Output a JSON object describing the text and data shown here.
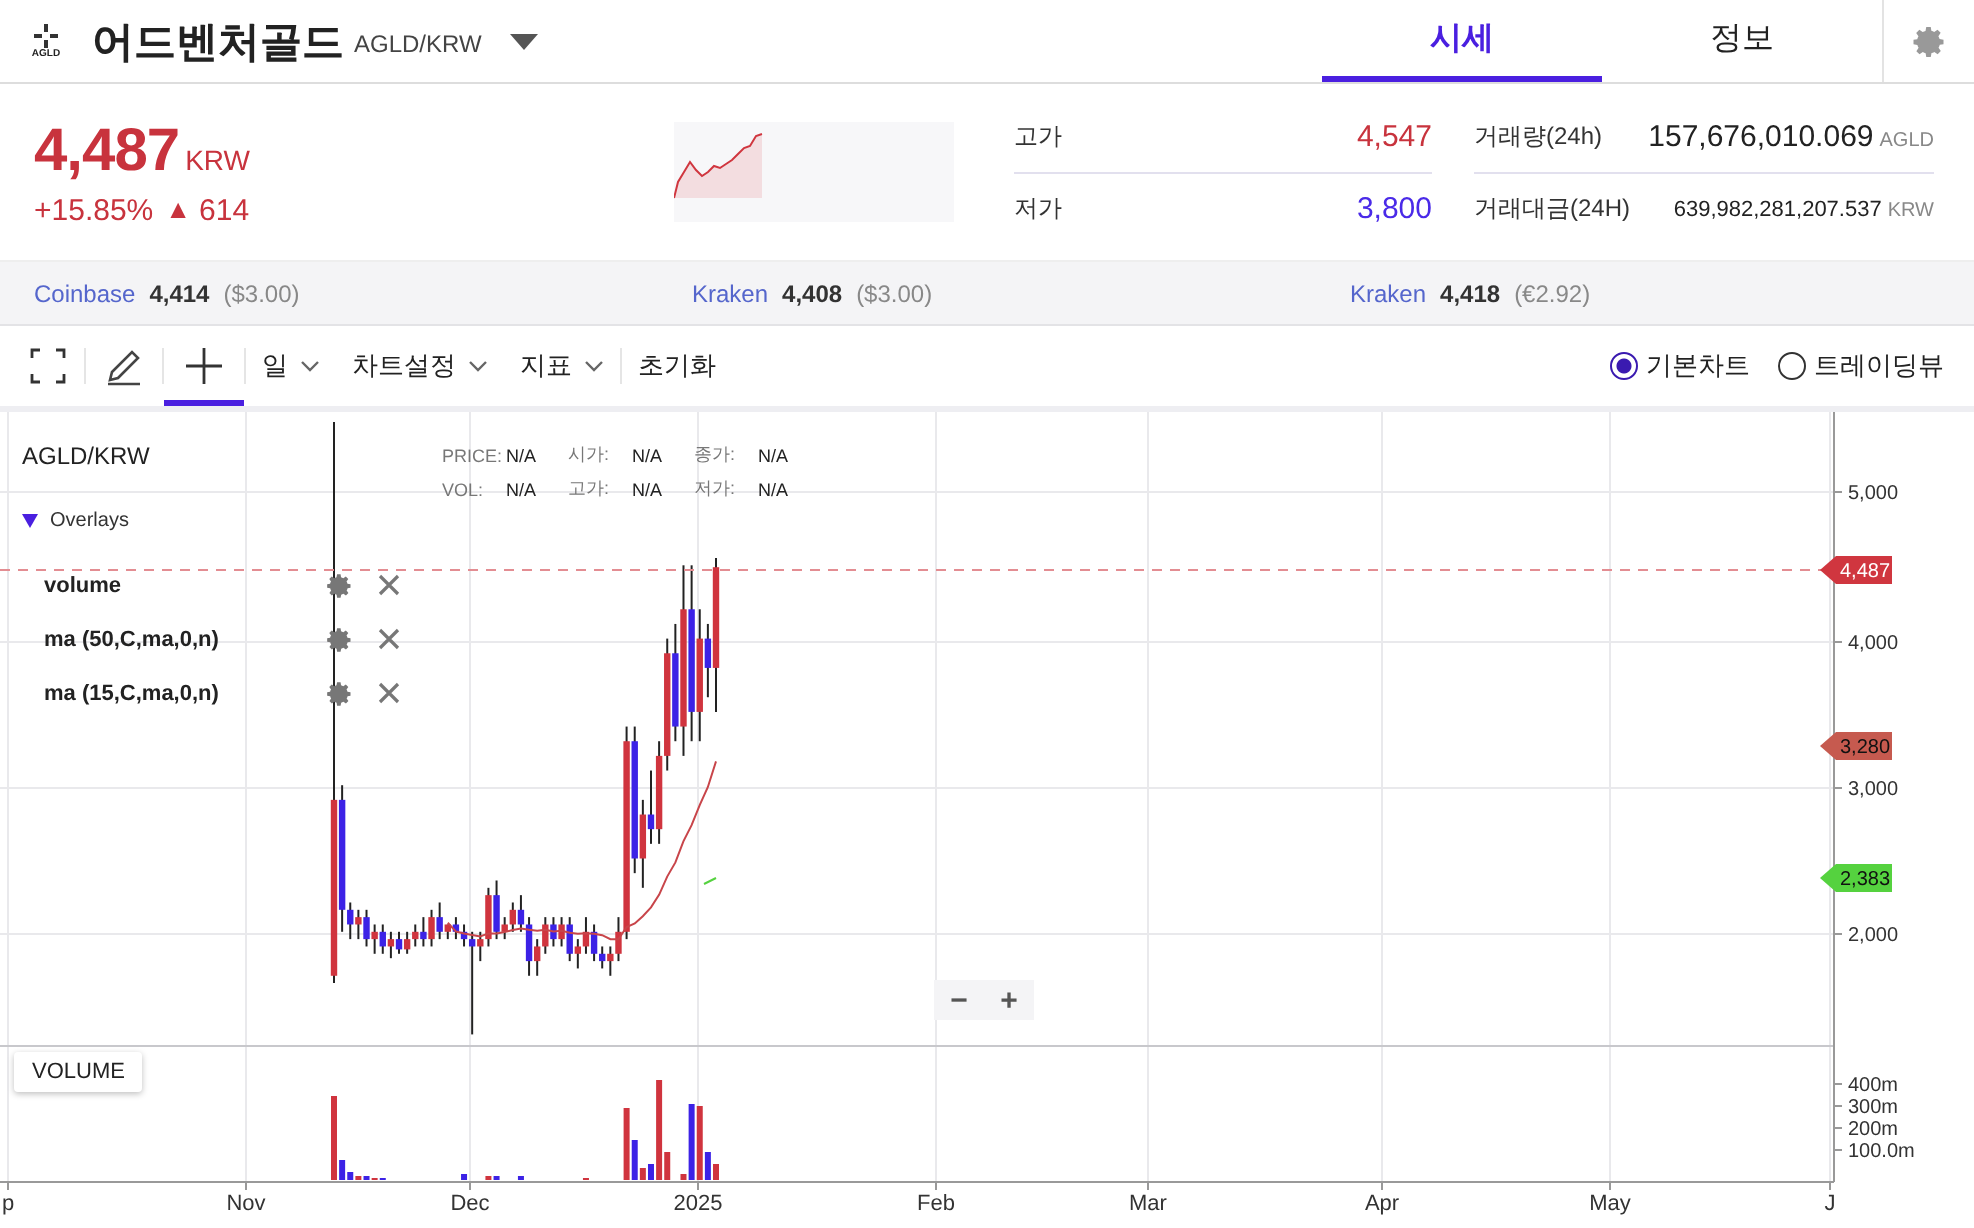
{
  "header": {
    "logo_text": "AGLD",
    "title": "어드벤처골드",
    "pair": "AGLD/KRW"
  },
  "tabs": [
    {
      "label": "시세",
      "selected": true
    },
    {
      "label": "정보",
      "selected": false
    }
  ],
  "price": {
    "value": "4,487",
    "unit": "KRW",
    "change_pct": "+15.85%",
    "change_arrow": "▲",
    "change_abs": "614"
  },
  "stats": [
    {
      "label": "고가",
      "value": "4,547",
      "kind": "up"
    },
    {
      "label": "거래량(24h)",
      "value": "157,676,010.069",
      "unit": "AGLD",
      "kind": "plain"
    },
    {
      "label": "저가",
      "value": "3,800",
      "kind": "down"
    },
    {
      "label": "거래대금(24H)",
      "value": "639,982,281,207.537",
      "unit": "KRW",
      "kind": "small"
    }
  ],
  "exchanges": [
    {
      "name": "Coinbase",
      "price": "4,414",
      "ref": "($3.00)"
    },
    {
      "name": "Kraken",
      "price": "4,408",
      "ref": "($3.00)"
    },
    {
      "name": "Kraken",
      "price": "4,418",
      "ref": "(€2.92)"
    }
  ],
  "tools": [
    {
      "kind": "fullscreen",
      "selected": false
    },
    {
      "kind": "pen",
      "selected": false
    },
    {
      "kind": "crosshair",
      "selected": true
    }
  ],
  "menus": [
    {
      "label": "일",
      "kind": "dropdown"
    },
    {
      "label": "차트설정",
      "kind": "dropdown"
    },
    {
      "label": "지표",
      "kind": "dropdown"
    },
    {
      "label": "초기화",
      "kind": "button"
    }
  ],
  "views": [
    {
      "label": "기본차트",
      "selected": true
    },
    {
      "label": "트레이딩뷰",
      "selected": false
    }
  ],
  "chart": {
    "symbol": "AGLD/KRW",
    "info": [
      [
        {
          "label": "PRICE:",
          "value": "N/A"
        },
        {
          "label": "시가:",
          "value": "N/A"
        },
        {
          "label": "종가:",
          "value": "N/A"
        }
      ],
      [
        {
          "label": "VOL:",
          "value": "N/A"
        },
        {
          "label": "고가:",
          "value": "N/A"
        },
        {
          "label": "저가:",
          "value": "N/A"
        }
      ]
    ],
    "overlays_label": "Overlays",
    "overlays_expanded": true,
    "overlays": [
      "volume",
      "ma (50,C,ma,0,n)",
      "ma (15,C,ma,0,n)"
    ],
    "y_ticks": [
      "5,000",
      "4,000",
      "3,000",
      "2,000"
    ],
    "price_tags": [
      {
        "text": "4,487",
        "color": "#d0363f",
        "kind": "last"
      },
      {
        "text": "3,280",
        "color": "#c65a4f",
        "kind": "indicator"
      },
      {
        "text": "2,383",
        "color": "#55d23f",
        "kind": "indicator"
      }
    ],
    "volume_label": "VOLUME",
    "volume_ticks": [
      "400m",
      "300m",
      "200m",
      "100.0m"
    ],
    "x_ticks": [
      "p",
      "Nov",
      "Dec",
      "2025",
      "Feb",
      "Mar",
      "Apr",
      "May",
      "J"
    ],
    "zoom_out": "−",
    "zoom_in": "+"
  }
}
